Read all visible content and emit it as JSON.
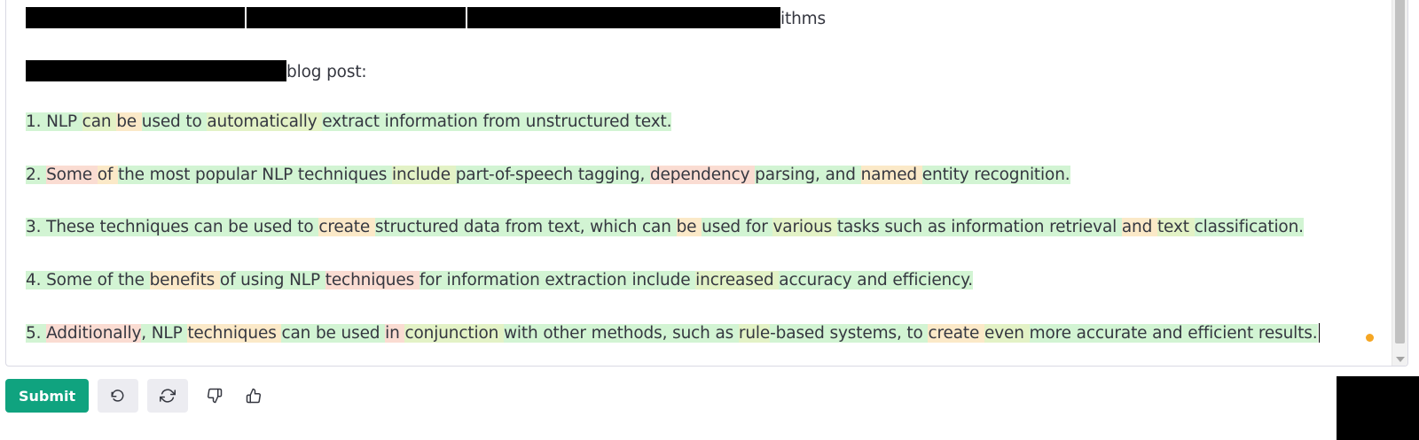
{
  "editor": {
    "line0_suffix": "ithms",
    "line1_suffix": "blog post:",
    "paragraphs": [
      [
        [
          "1. NLP ",
          "g"
        ],
        [
          "can ",
          "y"
        ],
        [
          "be ",
          "o"
        ],
        [
          "used to ",
          "g"
        ],
        [
          "automatically ",
          "y"
        ],
        [
          "extract information from unstructured text.",
          "g"
        ]
      ],
      [
        [
          "2. ",
          "g"
        ],
        [
          "Some ",
          "r"
        ],
        [
          "of ",
          "o"
        ],
        [
          "the most popular ",
          "g"
        ],
        [
          "NLP techniques ",
          "g"
        ],
        [
          "include ",
          "y"
        ],
        [
          "part-of-speech tagging, ",
          "g"
        ],
        [
          "dependency ",
          "r"
        ],
        [
          "parsing, and ",
          "g"
        ],
        [
          "named ",
          "o"
        ],
        [
          "entity recognition.",
          "g"
        ]
      ],
      [
        [
          "3. These techniques can be used to ",
          "g"
        ],
        [
          "create ",
          "o"
        ],
        [
          "structured data from text, which can ",
          "g"
        ],
        [
          "be ",
          "o"
        ],
        [
          "used for ",
          "g"
        ],
        [
          "various ",
          "y"
        ],
        [
          "tasks such as information retrieval ",
          "g"
        ],
        [
          "and ",
          "o"
        ],
        [
          "text ",
          "y"
        ],
        [
          "classification.",
          "g"
        ]
      ],
      [
        [
          "4. Some of the ",
          "g"
        ],
        [
          "benefits ",
          "o"
        ],
        [
          "of using NLP ",
          "g"
        ],
        [
          "techniques ",
          "r"
        ],
        [
          "for information extraction include ",
          "g"
        ],
        [
          "increased ",
          "y"
        ],
        [
          "accuracy and efficiency.",
          "g"
        ]
      ],
      [
        [
          "5. ",
          "g"
        ],
        [
          "Additionally",
          "r"
        ],
        [
          ", NLP ",
          "g"
        ],
        [
          "techniques ",
          "o"
        ],
        [
          "can be used ",
          "g"
        ],
        [
          "in ",
          "r"
        ],
        [
          "conjunction ",
          "y"
        ],
        [
          "with other methods, such as ",
          "g"
        ],
        [
          "rule",
          "y"
        ],
        [
          "-based systems, to ",
          "g"
        ],
        [
          "create ",
          "o"
        ],
        [
          "even ",
          "y"
        ],
        [
          "more accurate and efficient results.",
          "g"
        ]
      ]
    ]
  },
  "toolbar": {
    "submit_label": "Submit",
    "icons": [
      "undo-icon",
      "regenerate-icon",
      "thumbs-down-icon",
      "thumbs-up-icon"
    ]
  },
  "colors": {
    "accent": "#10a37f",
    "highlight_green": "#d2f4d3",
    "highlight_yellowgreen": "#e3f2c6",
    "highlight_orange": "#fbe9c8",
    "highlight_red": "#fadcd2",
    "status_dot": "#f5a623"
  }
}
